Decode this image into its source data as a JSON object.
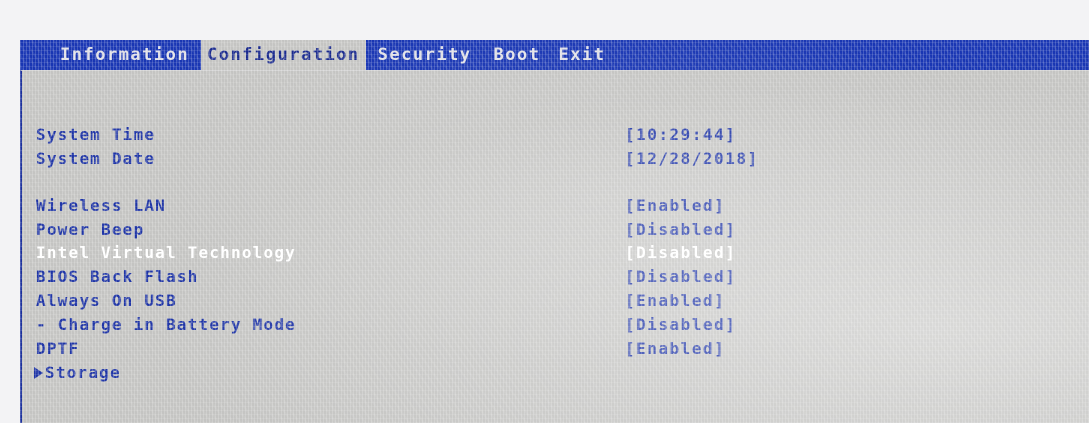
{
  "menu": {
    "tabs": [
      {
        "label": "Information"
      },
      {
        "label": "Configuration"
      },
      {
        "label": "Security"
      },
      {
        "label": "Boot"
      },
      {
        "label": "Exit"
      }
    ]
  },
  "settings": [
    {
      "label": "System Time",
      "value": "[10:29:44]"
    },
    {
      "label": "System Date",
      "value": "[12/28/2018]"
    },
    {
      "label": "Wireless LAN",
      "value": "[Enabled]"
    },
    {
      "label": "Power Beep",
      "value": "[Disabled]"
    },
    {
      "label": "Intel Virtual Technology",
      "value": "[Disabled]"
    },
    {
      "label": "BIOS Back Flash",
      "value": "[Disabled]"
    },
    {
      "label": "Always On USB",
      "value": "[Enabled]"
    },
    {
      "label": "- Charge in Battery Mode",
      "value": "[Disabled]"
    },
    {
      "label": "DPTF",
      "value": "[Enabled]"
    },
    {
      "label": "Storage"
    }
  ],
  "colors": {
    "menubar": "#1936b3",
    "screen_bg": "#c4c4c2",
    "text": "#1f35a6",
    "highlight_text": "#ffffff"
  }
}
